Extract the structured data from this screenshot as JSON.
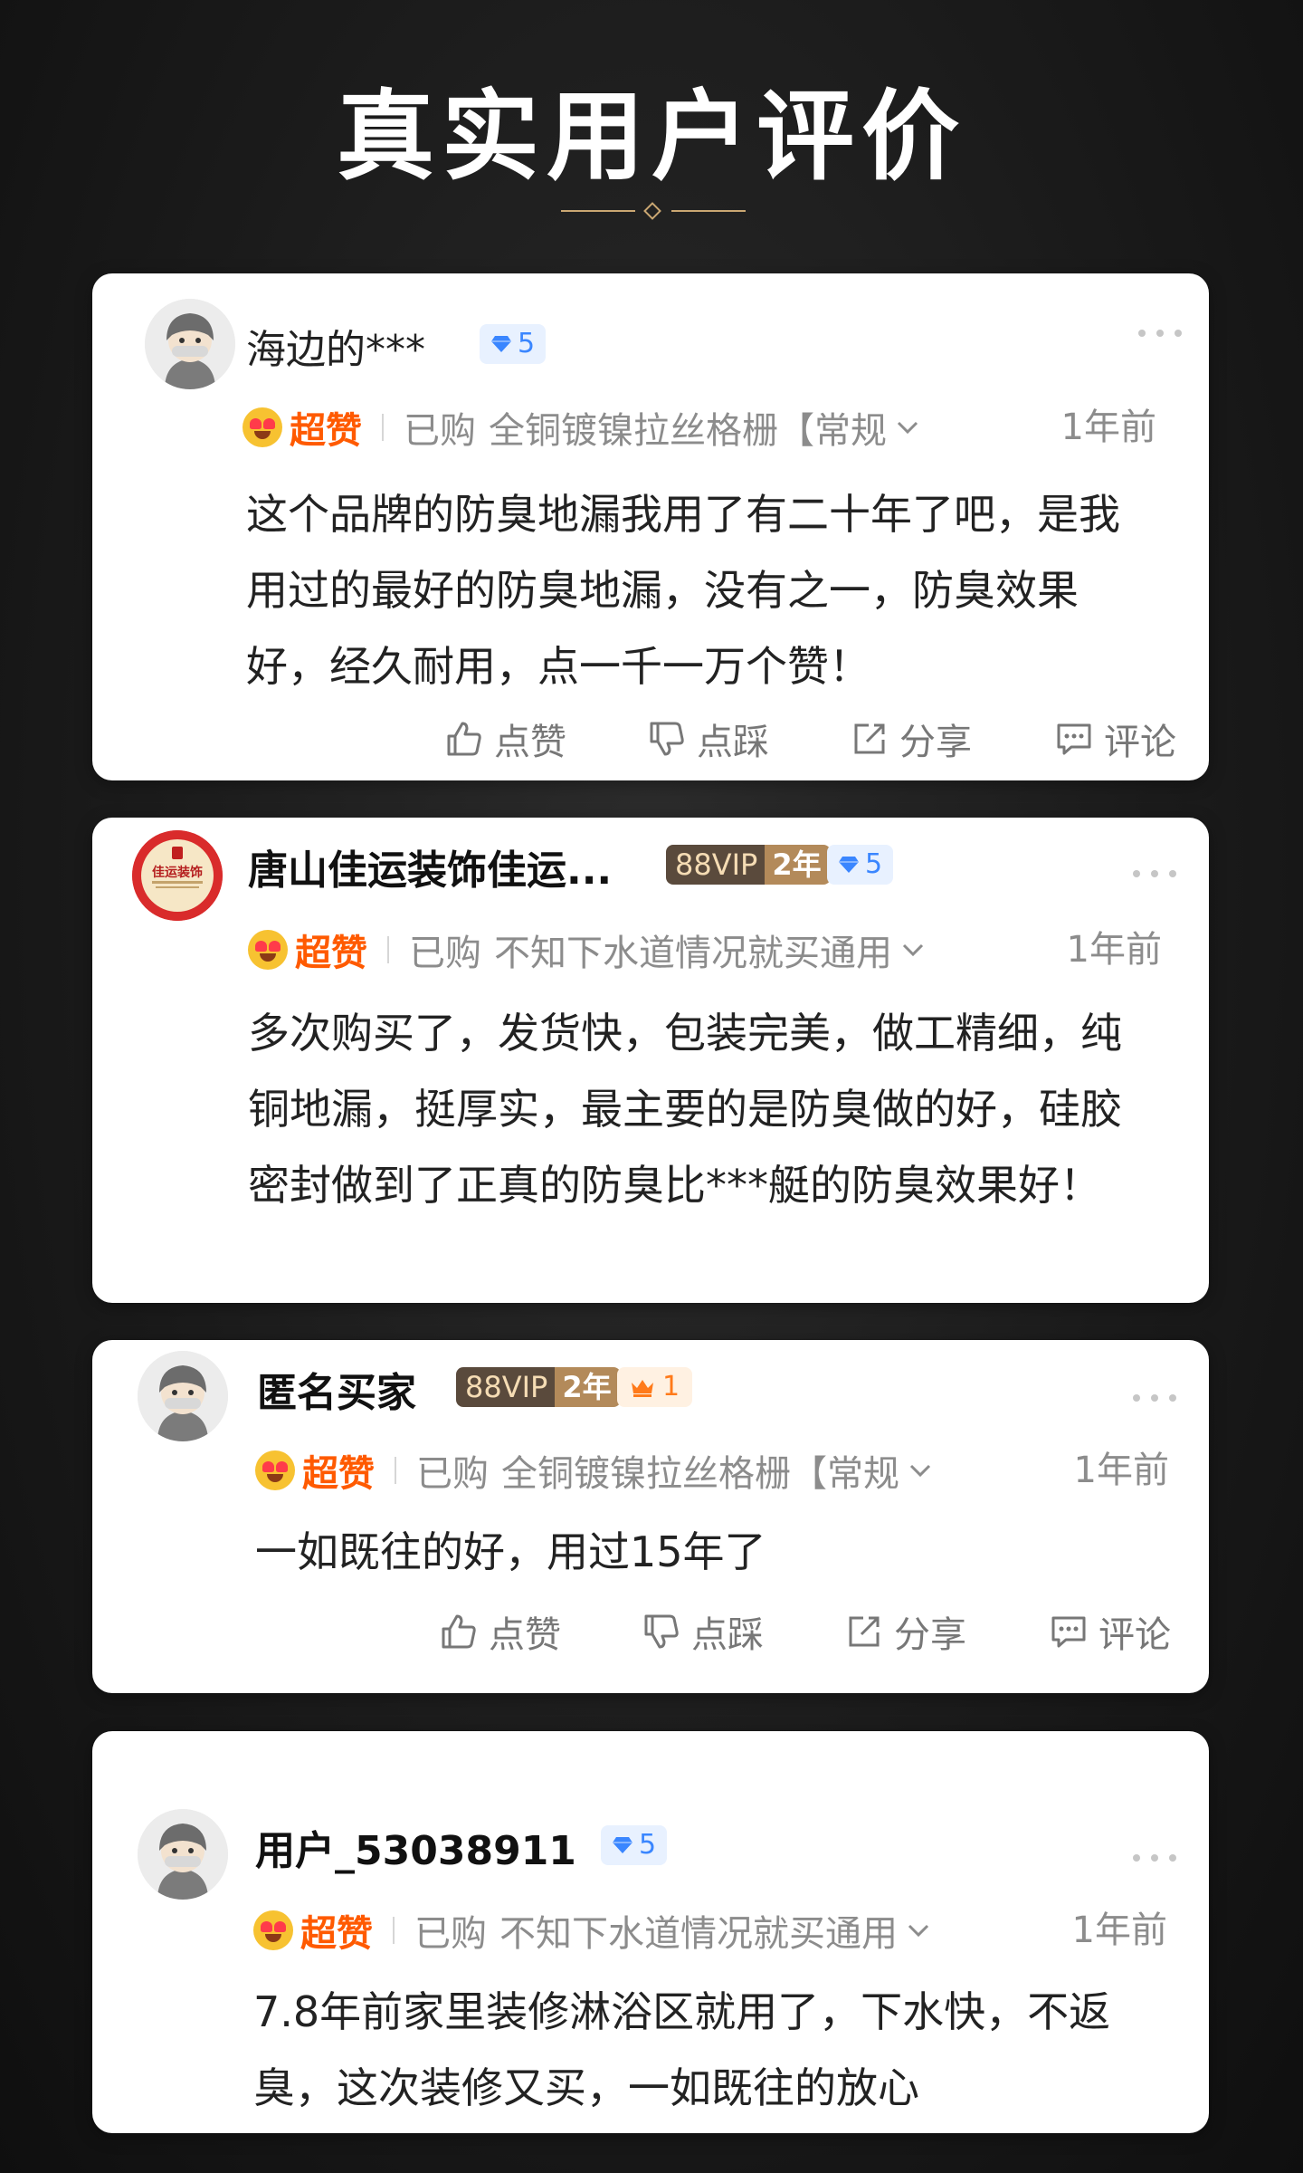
{
  "page": {
    "title": "真实用户评价"
  },
  "actions": {
    "like": "点赞",
    "dislike": "点踩",
    "share": "分享",
    "comment": "评论"
  },
  "reviews": [
    {
      "username": "海边的***",
      "gem_level": "5",
      "super_like": "超赞",
      "bought_label": "已购",
      "variant": "全铜镀镍拉丝格栅【常规",
      "time": "1年前",
      "text": "这个品牌的防臭地漏我用了有二十年了吧，是我用过的最好的防臭地漏，没有之一，防臭效果好，经久耐用，点一千一万个赞！"
    },
    {
      "username": "唐山佳运装饰佳运...",
      "vip_label": "88VIP",
      "vip_years": "2年",
      "gem_level": "5",
      "avatar_logo_text": "佳运装饰",
      "super_like": "超赞",
      "bought_label": "已购",
      "variant": "不知下水道情况就买通用",
      "time": "1年前",
      "text": "多次购买了，发货快，包装完美，做工精细，纯铜地漏，挺厚实，最主要的是防臭做的好，硅胶密封做到了正真的防臭比***艇的防臭效果好！"
    },
    {
      "username": "匿名买家",
      "vip_label": "88VIP",
      "vip_years": "2年",
      "crown_level": "1",
      "super_like": "超赞",
      "bought_label": "已购",
      "variant": "全铜镀镍拉丝格栅【常规",
      "time": "1年前",
      "text": "一如既往的好，用过15年了"
    },
    {
      "username": "用户_53038911",
      "gem_level": "5",
      "super_like": "超赞",
      "bought_label": "已购",
      "variant": "不知下水道情况就买通用",
      "time": "1年前",
      "text": "7.8年前家里装修淋浴区就用了，下水快，不返臭，这次装修又买，一如既往的放心"
    }
  ],
  "colors": {
    "accent_orange": "#ff5a00",
    "gold": "#caa772",
    "gem_blue": "#3a86ff"
  }
}
